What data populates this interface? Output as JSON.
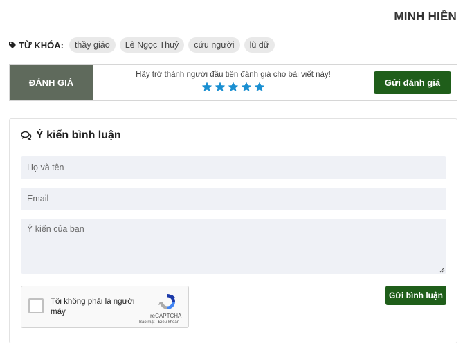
{
  "author": "MINH HIỀN",
  "tags": {
    "label": "TỪ KHÓA:",
    "icon": "tag-icon",
    "items": [
      "thầy giáo",
      "Lê Ngọc Thuỷ",
      "cứu người",
      "lũ dữ"
    ]
  },
  "rating": {
    "label": "ĐÁNH GIÁ",
    "prompt": "Hãy trở thành người đầu tiên đánh giá cho bài viết này!",
    "stars": 5,
    "star_color": "#1a8fd1",
    "button": "Gửi đánh giá"
  },
  "comments": {
    "title": "Ý kiến bình luận",
    "icon": "comments-icon",
    "name_placeholder": "Họ và tên",
    "email_placeholder": "Email",
    "message_placeholder": "Ý kiến của bạn",
    "captcha": {
      "text": "Tôi không phải là người máy",
      "brand": "reCAPTCHA",
      "links": "Bảo mật - Điều khoản"
    },
    "submit": "Gửi bình luận"
  },
  "colors": {
    "accent": "#1f5e1a",
    "rating_label_bg": "#5f6a5c",
    "field_bg": "#eff1f6",
    "tag_bg": "#e9e9e9"
  }
}
